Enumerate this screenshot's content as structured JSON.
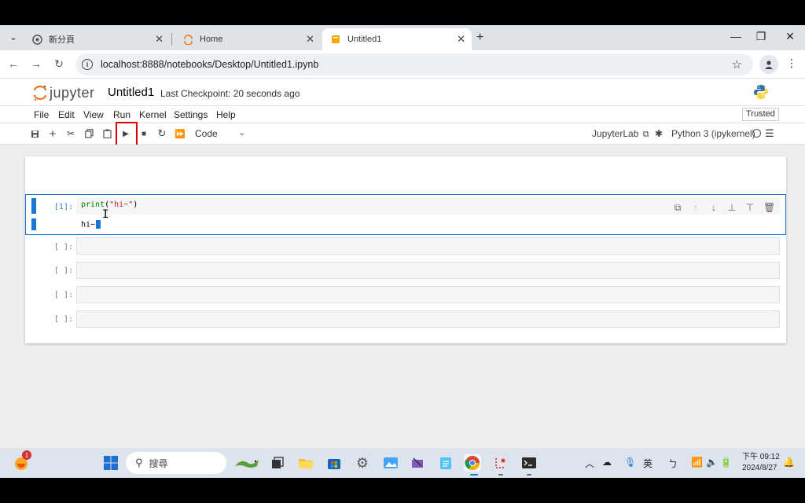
{
  "browser": {
    "tabs": [
      {
        "label": "新分頁",
        "active": false
      },
      {
        "label": "Home",
        "active": false
      },
      {
        "label": "Untitled1",
        "active": true
      }
    ],
    "url": "localhost:8888/notebooks/Desktop/Untitled1.ipynb",
    "new_tab_symbol": "+",
    "window_controls": [
      "—",
      "❐",
      "✕"
    ]
  },
  "jupyter": {
    "logo_text": "jupyter",
    "notebook_title": "Untitled1",
    "checkpoint": "Last Checkpoint: 20 seconds ago",
    "menu": [
      "File",
      "Edit",
      "View",
      "Run",
      "Kernel",
      "Settings",
      "Help"
    ],
    "trusted": "Trusted",
    "cell_type": "Code",
    "jupyterlab_link": "JupyterLab",
    "kernel": "Python 3 (ipykernel)"
  },
  "cells": [
    {
      "prompt": "[1]:",
      "code_fn": "print",
      "code_open": "(",
      "code_str": "\"hi~\"",
      "code_close": ")",
      "output": "hi~"
    },
    {
      "prompt": "[ ]:"
    },
    {
      "prompt": "[ ]:"
    },
    {
      "prompt": "[ ]:"
    },
    {
      "prompt": "[ ]:"
    }
  ],
  "taskbar": {
    "search_placeholder": "搜尋",
    "notification_count": "1",
    "ime": "英",
    "time": "下午 09:12",
    "date": "2024/8/27"
  },
  "colors": {
    "accent": "#1976d2",
    "highlight_box": "#e00000"
  }
}
